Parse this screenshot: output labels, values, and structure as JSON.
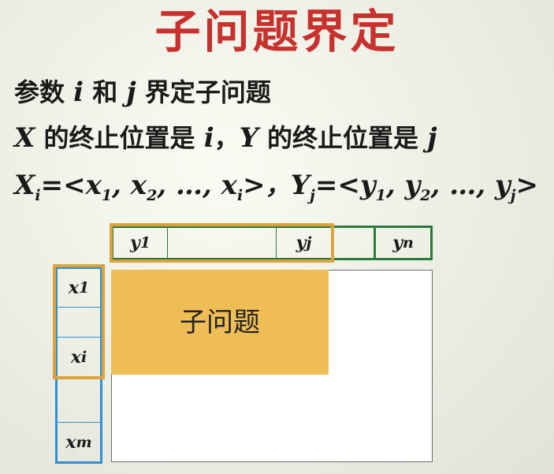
{
  "title": "子问题界定",
  "line1": {
    "a": "参数 ",
    "i": "i",
    "b": " 和 ",
    "j": "j",
    "c": " 界定子问题"
  },
  "line2": {
    "X": "X",
    "a": " 的终止位置是 ",
    "i": "i",
    "comma": "，",
    "Y": "Y",
    "b": " 的终止位置是 ",
    "j": "j"
  },
  "line3": {
    "X": "X",
    "Xsub": "i",
    "eq1": "=<",
    "x": "x",
    "s1": "1",
    "c1": ", ",
    "s2": "2",
    "c2": ", …, ",
    "si": "i",
    "end1": ">",
    "sep": "，",
    "Y": "Y",
    "Ysub": "j",
    "eq2": "=<",
    "y": "y",
    "t1": "1",
    "d1": ", ",
    "t2": "2",
    "d2": ", …, ",
    "tj": "j",
    "end2": ">"
  },
  "y_cells": {
    "y1": "y",
    "y1_sub": "1",
    "yj": "y",
    "yj_sub": "j",
    "yn": "y",
    "yn_sub": "n"
  },
  "x_cells": {
    "x1": "x",
    "x1_sub": "1",
    "xi": "x",
    "xi_sub": "i",
    "xm": "x",
    "xm_sub": "m"
  },
  "subproblem_label": "子问题",
  "colors": {
    "title": "#c8322e",
    "y_border": "#2b7a3b",
    "x_border": "#2d8fd6",
    "highlight": "#d9a340",
    "subproblem_fill": "#eebd55"
  }
}
